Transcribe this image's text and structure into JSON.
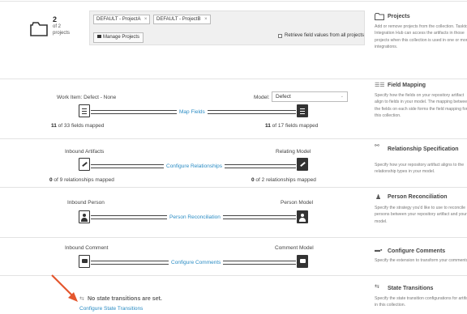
{
  "projects": {
    "count": "2",
    "of_total": "of 2",
    "noun": "projects",
    "chips": [
      "DEFAULT - ProjectA",
      "DEFAULT - ProjectB"
    ],
    "chip_close": "×",
    "manage_label": "Manage Projects",
    "retrieve_label": "Retrieve field values from all projects"
  },
  "field_mapping": {
    "left_label": "Work Item: Defect - None",
    "model_label": "Model:",
    "model_value": "Defect",
    "button": "Map Fields",
    "left_count": "11",
    "left_suffix": " of 33 fields mapped",
    "right_count": "11",
    "right_suffix": " of 17 fields mapped"
  },
  "relationship": {
    "left_label": "Inbound Artifacts",
    "right_label": "Relating Model",
    "button": "Configure Relationships",
    "left_count": "0",
    "left_suffix": " of 9 relationships mapped",
    "right_count": "0",
    "right_suffix": " of 2 relationships mapped"
  },
  "person": {
    "left_label": "Inbound Person",
    "right_label": "Person Model",
    "button": "Person Reconciliation"
  },
  "comment": {
    "left_label": "Inbound Comment",
    "right_label": "Comment Model",
    "button": "Configure Comments"
  },
  "state": {
    "message": "No state transitions are set.",
    "link": "Configure State Transitions"
  },
  "sidebar": {
    "projects": {
      "title": "Projects",
      "desc": "Add or remove projects from the collection. Tasktop Integration Hub can access the artifacts in those projects when this collection is used in one or more integrations.",
      "icon": "folder-icon"
    },
    "field_mapping": {
      "title": "Field Mapping",
      "desc": "Specify how the fields on your repository artifact align to fields in your model. The mapping between the fields on each side forms the field mapping for this collection.",
      "icon": "field-mapping-icon"
    },
    "relationship": {
      "title": "Relationship Specification",
      "desc": "Specify how your repository artifact aligns to the relationship types in your model.",
      "icon": "relationship-icon"
    },
    "person": {
      "title": "Person Reconciliation",
      "desc": "Specify the strategy you'd like to use to reconcile persons between your repository artifact and your model.",
      "icon": "person-icon"
    },
    "comments": {
      "title": "Configure Comments",
      "desc": "Specify the extension to transform your comments.",
      "icon": "comments-icon"
    },
    "state": {
      "title": "State Transitions",
      "desc": "Specify the state transition configurations for artifacts in this collection.",
      "icon": "state-transitions-icon"
    }
  },
  "colors": {
    "link": "#2b8cc4",
    "arrow": "#e4572e",
    "divider": "#e3e3e3"
  }
}
